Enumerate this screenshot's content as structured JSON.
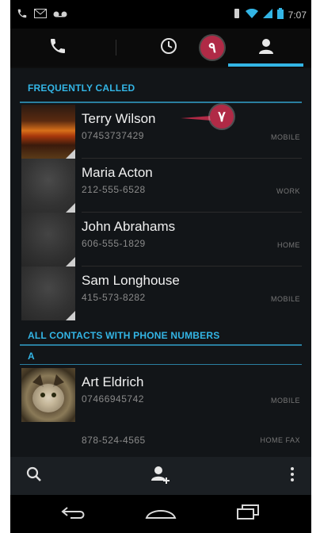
{
  "status_bar": {
    "left_icons": [
      "phone-call-icon",
      "message-icon",
      "voicemail-icon"
    ],
    "right_icons": [
      "vibrate-icon",
      "wifi-icon",
      "signal-icon",
      "battery-icon"
    ],
    "time": "7:07"
  },
  "tabs": [
    {
      "icon": "phone-icon",
      "name": "dialpad"
    },
    {
      "icon": "clock-icon",
      "name": "call-log"
    },
    {
      "icon": "person-icon",
      "name": "favorites",
      "selected": true
    }
  ],
  "callouts": [
    "٩",
    "٧"
  ],
  "sections": {
    "frequent": "FREQUENTLY CALLED",
    "all": "ALL CONTACTS WITH PHONE NUMBERS",
    "letter_a": "A"
  },
  "frequent_contacts": [
    {
      "name": "Terry Wilson",
      "phone": "07453737429",
      "type": "MOBILE"
    },
    {
      "name": "Maria Acton",
      "phone": "212-555-6528",
      "type": "WORK"
    },
    {
      "name": "John Abrahams",
      "phone": "606-555-1829",
      "type": "HOME"
    },
    {
      "name": "Sam Longhouse",
      "phone": "415-573-8282",
      "type": "MOBILE"
    }
  ],
  "all_contacts": [
    {
      "name": "Art Eldrich",
      "phone": "07466945742",
      "type": "MOBILE"
    }
  ],
  "extra_number": {
    "phone": "878-524-4565",
    "type": "HOME FAX"
  },
  "action_bar": [
    "search-icon",
    "add-contact-icon",
    "overflow-menu-icon"
  ],
  "nav_bar": [
    "back-icon",
    "home-icon",
    "recent-apps-icon"
  ],
  "colors": {
    "accent": "#33b5e5",
    "callout": "#b02a46"
  }
}
